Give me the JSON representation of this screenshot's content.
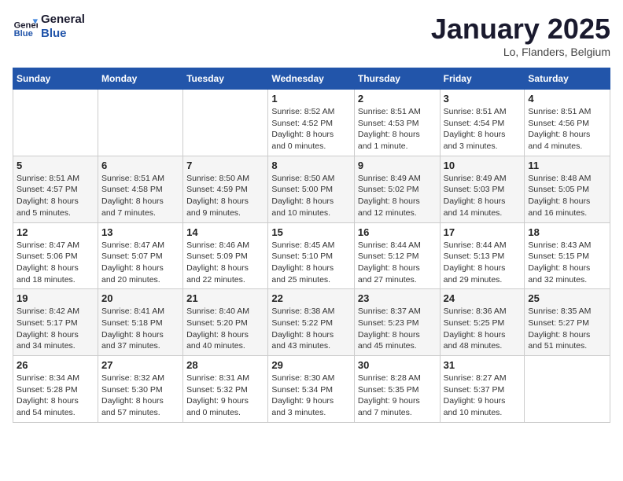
{
  "logo": {
    "text_general": "General",
    "text_blue": "Blue"
  },
  "header": {
    "title": "January 2025",
    "subtitle": "Lo, Flanders, Belgium"
  },
  "days_of_week": [
    "Sunday",
    "Monday",
    "Tuesday",
    "Wednesday",
    "Thursday",
    "Friday",
    "Saturday"
  ],
  "weeks": [
    [
      {
        "day": "",
        "info": ""
      },
      {
        "day": "",
        "info": ""
      },
      {
        "day": "",
        "info": ""
      },
      {
        "day": "1",
        "info": "Sunrise: 8:52 AM\nSunset: 4:52 PM\nDaylight: 8 hours\nand 0 minutes."
      },
      {
        "day": "2",
        "info": "Sunrise: 8:51 AM\nSunset: 4:53 PM\nDaylight: 8 hours\nand 1 minute."
      },
      {
        "day": "3",
        "info": "Sunrise: 8:51 AM\nSunset: 4:54 PM\nDaylight: 8 hours\nand 3 minutes."
      },
      {
        "day": "4",
        "info": "Sunrise: 8:51 AM\nSunset: 4:56 PM\nDaylight: 8 hours\nand 4 minutes."
      }
    ],
    [
      {
        "day": "5",
        "info": "Sunrise: 8:51 AM\nSunset: 4:57 PM\nDaylight: 8 hours\nand 5 minutes."
      },
      {
        "day": "6",
        "info": "Sunrise: 8:51 AM\nSunset: 4:58 PM\nDaylight: 8 hours\nand 7 minutes."
      },
      {
        "day": "7",
        "info": "Sunrise: 8:50 AM\nSunset: 4:59 PM\nDaylight: 8 hours\nand 9 minutes."
      },
      {
        "day": "8",
        "info": "Sunrise: 8:50 AM\nSunset: 5:00 PM\nDaylight: 8 hours\nand 10 minutes."
      },
      {
        "day": "9",
        "info": "Sunrise: 8:49 AM\nSunset: 5:02 PM\nDaylight: 8 hours\nand 12 minutes."
      },
      {
        "day": "10",
        "info": "Sunrise: 8:49 AM\nSunset: 5:03 PM\nDaylight: 8 hours\nand 14 minutes."
      },
      {
        "day": "11",
        "info": "Sunrise: 8:48 AM\nSunset: 5:05 PM\nDaylight: 8 hours\nand 16 minutes."
      }
    ],
    [
      {
        "day": "12",
        "info": "Sunrise: 8:47 AM\nSunset: 5:06 PM\nDaylight: 8 hours\nand 18 minutes."
      },
      {
        "day": "13",
        "info": "Sunrise: 8:47 AM\nSunset: 5:07 PM\nDaylight: 8 hours\nand 20 minutes."
      },
      {
        "day": "14",
        "info": "Sunrise: 8:46 AM\nSunset: 5:09 PM\nDaylight: 8 hours\nand 22 minutes."
      },
      {
        "day": "15",
        "info": "Sunrise: 8:45 AM\nSunset: 5:10 PM\nDaylight: 8 hours\nand 25 minutes."
      },
      {
        "day": "16",
        "info": "Sunrise: 8:44 AM\nSunset: 5:12 PM\nDaylight: 8 hours\nand 27 minutes."
      },
      {
        "day": "17",
        "info": "Sunrise: 8:44 AM\nSunset: 5:13 PM\nDaylight: 8 hours\nand 29 minutes."
      },
      {
        "day": "18",
        "info": "Sunrise: 8:43 AM\nSunset: 5:15 PM\nDaylight: 8 hours\nand 32 minutes."
      }
    ],
    [
      {
        "day": "19",
        "info": "Sunrise: 8:42 AM\nSunset: 5:17 PM\nDaylight: 8 hours\nand 34 minutes."
      },
      {
        "day": "20",
        "info": "Sunrise: 8:41 AM\nSunset: 5:18 PM\nDaylight: 8 hours\nand 37 minutes."
      },
      {
        "day": "21",
        "info": "Sunrise: 8:40 AM\nSunset: 5:20 PM\nDaylight: 8 hours\nand 40 minutes."
      },
      {
        "day": "22",
        "info": "Sunrise: 8:38 AM\nSunset: 5:22 PM\nDaylight: 8 hours\nand 43 minutes."
      },
      {
        "day": "23",
        "info": "Sunrise: 8:37 AM\nSunset: 5:23 PM\nDaylight: 8 hours\nand 45 minutes."
      },
      {
        "day": "24",
        "info": "Sunrise: 8:36 AM\nSunset: 5:25 PM\nDaylight: 8 hours\nand 48 minutes."
      },
      {
        "day": "25",
        "info": "Sunrise: 8:35 AM\nSunset: 5:27 PM\nDaylight: 8 hours\nand 51 minutes."
      }
    ],
    [
      {
        "day": "26",
        "info": "Sunrise: 8:34 AM\nSunset: 5:28 PM\nDaylight: 8 hours\nand 54 minutes."
      },
      {
        "day": "27",
        "info": "Sunrise: 8:32 AM\nSunset: 5:30 PM\nDaylight: 8 hours\nand 57 minutes."
      },
      {
        "day": "28",
        "info": "Sunrise: 8:31 AM\nSunset: 5:32 PM\nDaylight: 9 hours\nand 0 minutes."
      },
      {
        "day": "29",
        "info": "Sunrise: 8:30 AM\nSunset: 5:34 PM\nDaylight: 9 hours\nand 3 minutes."
      },
      {
        "day": "30",
        "info": "Sunrise: 8:28 AM\nSunset: 5:35 PM\nDaylight: 9 hours\nand 7 minutes."
      },
      {
        "day": "31",
        "info": "Sunrise: 8:27 AM\nSunset: 5:37 PM\nDaylight: 9 hours\nand 10 minutes."
      },
      {
        "day": "",
        "info": ""
      }
    ]
  ]
}
